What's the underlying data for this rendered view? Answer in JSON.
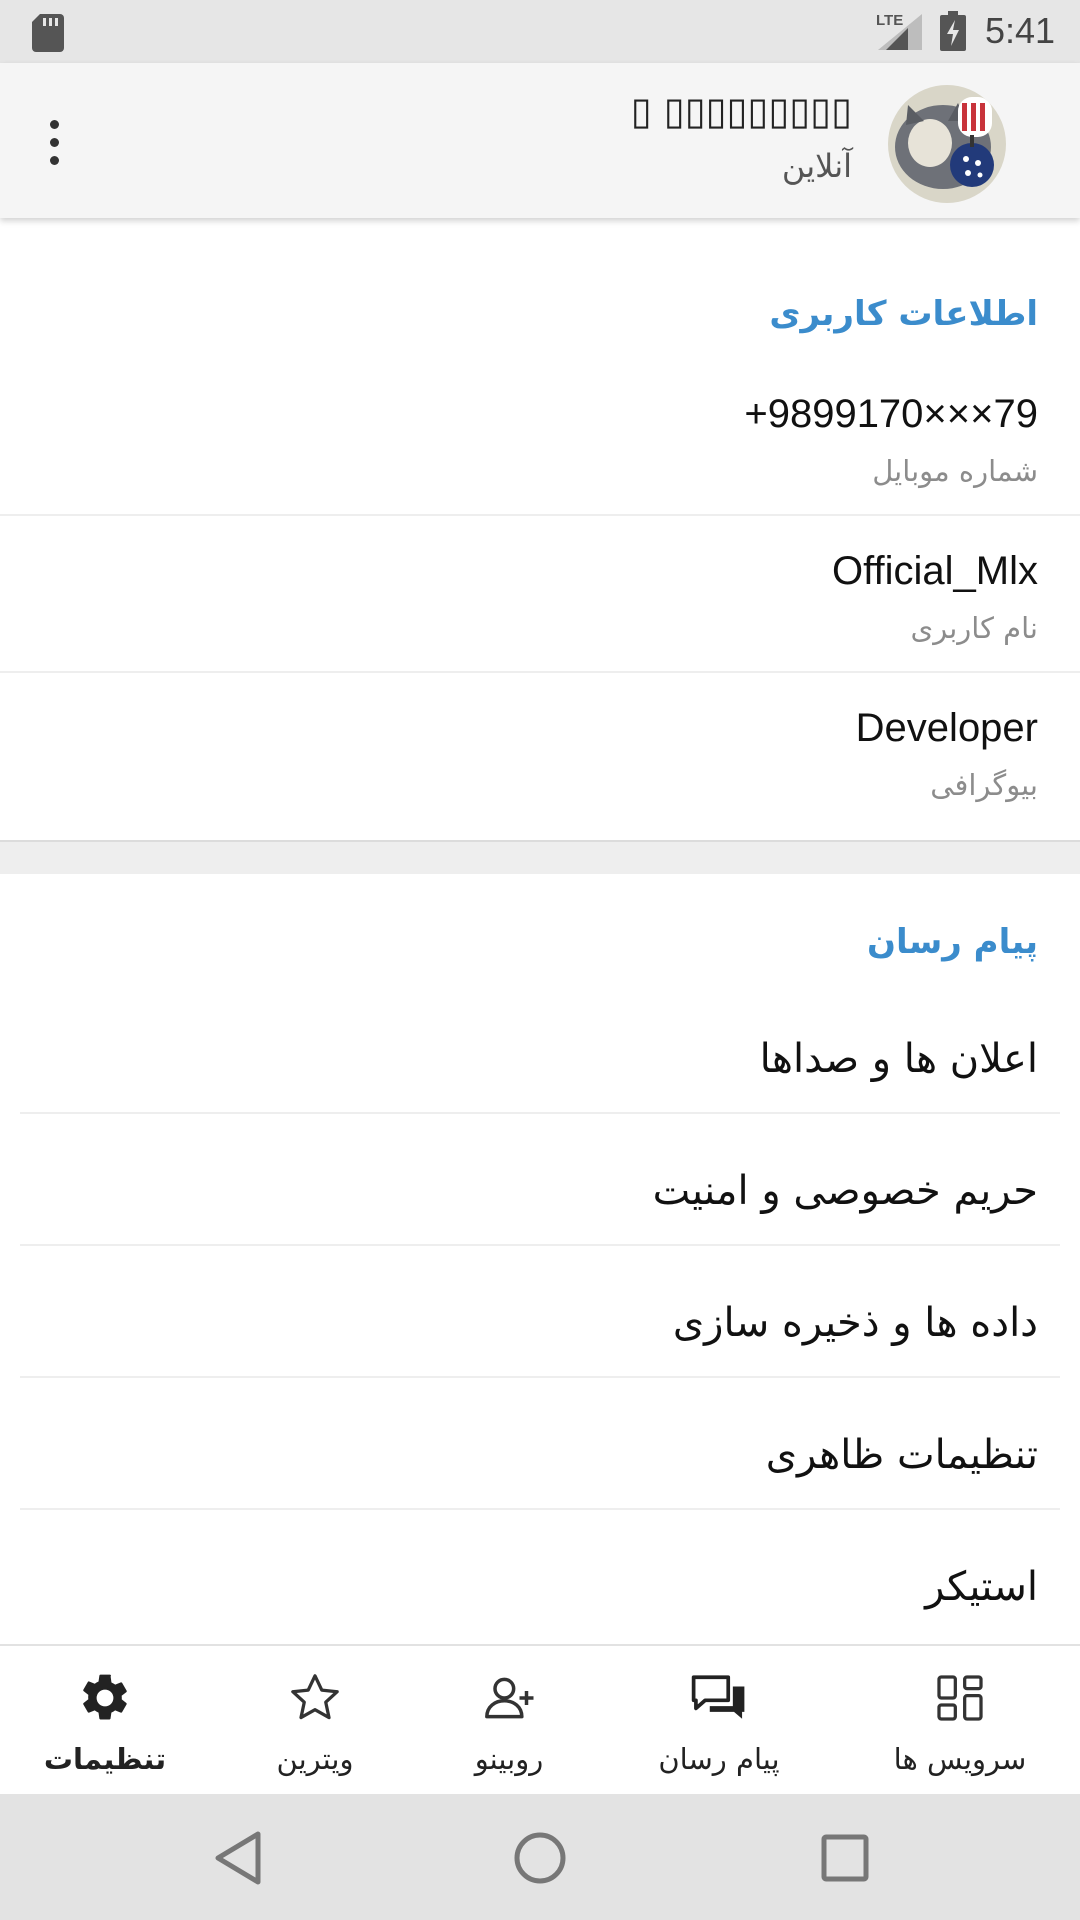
{
  "status_bar": {
    "network_type": "LTE",
    "time": "5:41",
    "icons": [
      "sd-card-icon",
      "signal-icon",
      "battery-charging-icon"
    ]
  },
  "header": {
    "name": "▯▯▯▯▯▯▯▯▯ ▯",
    "status": "آنلاین",
    "menu_icon": "more-vertical-icon",
    "avatar_icon": "profile-avatar"
  },
  "user_info": {
    "title": "اطلاعات کاربری",
    "phone": {
      "value": "+9899170×××79",
      "label": "شماره موبایل"
    },
    "username": {
      "value": "Official_Mlx",
      "label": "نام کاربری"
    },
    "bio": {
      "value": "Developer",
      "label": "بیوگرافی"
    }
  },
  "messenger": {
    "title": "پیام رسان",
    "items": [
      {
        "label": "اعلان ها و صداها"
      },
      {
        "label": "حریم خصوصی و امنیت"
      },
      {
        "label": "داده ها و ذخیره سازی"
      },
      {
        "label": "تنظیمات ظاهری"
      },
      {
        "label": "استیکر"
      }
    ]
  },
  "bottom_nav": {
    "items": [
      {
        "label": "تنظیمات",
        "icon": "gear-icon",
        "active": true
      },
      {
        "label": "ویترین",
        "icon": "star-icon",
        "active": false
      },
      {
        "label": "روبینو",
        "icon": "add-user-icon",
        "active": false
      },
      {
        "label": "پیام رسان",
        "icon": "chat-icon",
        "active": false
      },
      {
        "label": "سرویس ها",
        "icon": "grid-icon",
        "active": false
      }
    ]
  },
  "system_nav": {
    "icons": [
      "back-icon",
      "home-icon",
      "recents-icon"
    ]
  },
  "colors": {
    "accent": "#3b8ccc",
    "status_bar": "#e6e6e6",
    "header_bg": "#f5f5f5",
    "system_nav": "#e3e3e3"
  }
}
